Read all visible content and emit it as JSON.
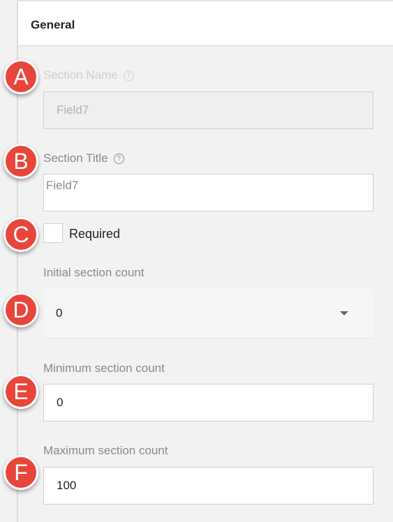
{
  "header": {
    "title": "General"
  },
  "fields": {
    "section_name": {
      "label": "Section Name",
      "value": "Field7",
      "help_icon": "question-circle-icon"
    },
    "section_title": {
      "label": "Section Title",
      "value": "Field7",
      "help_icon": "question-circle-icon"
    },
    "required": {
      "label": "Required",
      "checked": false
    },
    "initial_count": {
      "label": "Initial section count",
      "value": "0"
    },
    "minimum_count": {
      "label": "Minimum section count",
      "value": "0"
    },
    "maximum_count": {
      "label": "Maximum section count",
      "value": "100"
    }
  },
  "markers": [
    "A",
    "B",
    "C",
    "D",
    "E",
    "F"
  ],
  "colors": {
    "marker": "#e8463b",
    "panel_bg": "#f2f2f2"
  }
}
